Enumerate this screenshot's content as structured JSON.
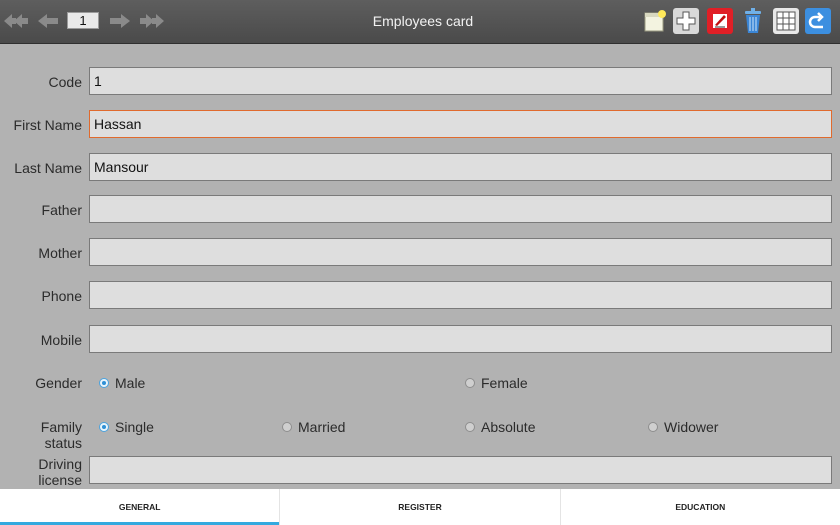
{
  "toolbar": {
    "title": "Employees card",
    "page_number": "1",
    "nav_icons": [
      "first-page-icon",
      "previous-page-icon",
      "next-page-icon",
      "last-page-icon"
    ],
    "action_icons": [
      "new-note-icon",
      "add-icon",
      "edit-icon",
      "delete-icon",
      "grid-icon",
      "back-icon"
    ]
  },
  "form": {
    "code": {
      "label": "Code",
      "value": "1"
    },
    "first_name": {
      "label": "First Name",
      "value": "Hassan"
    },
    "last_name": {
      "label": "Last Name",
      "value": "Mansour"
    },
    "father": {
      "label": "Father",
      "value": ""
    },
    "mother": {
      "label": "Mother",
      "value": ""
    },
    "phone": {
      "label": "Phone",
      "value": ""
    },
    "mobile": {
      "label": "Mobile",
      "value": ""
    },
    "gender": {
      "label": "Gender",
      "options": [
        "Male",
        "Female"
      ],
      "selected": "Male"
    },
    "family_status": {
      "label": "Family status",
      "options": [
        "Single",
        "Married",
        "Absolute",
        "Widower"
      ],
      "selected": "Single"
    },
    "driving_license": {
      "label": "Driving license",
      "value": ""
    }
  },
  "tabs": [
    "GENERAL",
    "REGISTER",
    "EDUCATION"
  ],
  "selected_tab": "GENERAL",
  "colors": {
    "accent": "#33a9df",
    "focus_border": "#e06a2d",
    "toolbar": "#555555",
    "background": "#b2b2b2"
  }
}
